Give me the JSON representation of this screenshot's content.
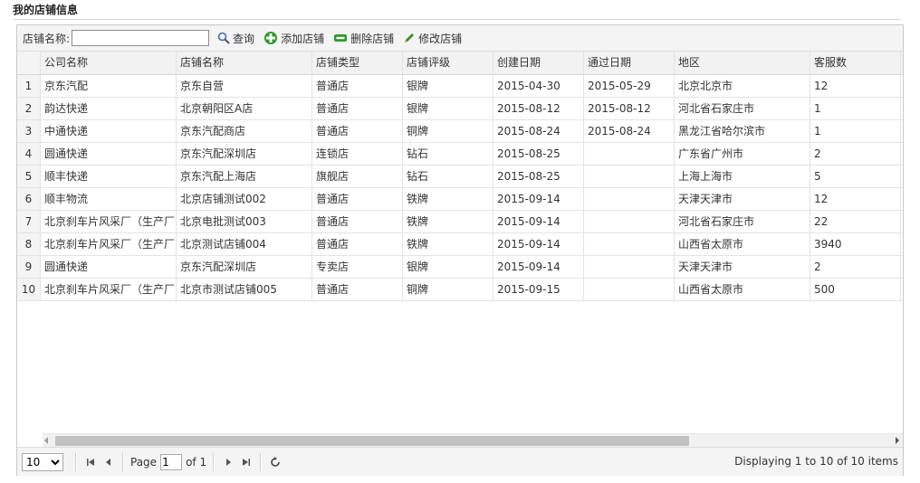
{
  "page_title": "我的店铺信息",
  "toolbar": {
    "search_label": "店铺名称:",
    "search_value": "",
    "query_label": "查询",
    "add_label": "添加店铺",
    "delete_label": "删除店铺",
    "edit_label": "修改店铺"
  },
  "columns": [
    "公司名称",
    "店铺名称",
    "店铺类型",
    "店铺评级",
    "创建日期",
    "通过日期",
    "地区",
    "客服数"
  ],
  "rows": [
    {
      "n": "1",
      "cells": [
        "京东汽配",
        "京东自营",
        "普通店",
        "银牌",
        "2015-04-30",
        "2015-05-29",
        "北京北京市",
        "12"
      ]
    },
    {
      "n": "2",
      "cells": [
        "韵达快递",
        "北京朝阳区A店",
        "普通店",
        "银牌",
        "2015-08-12",
        "2015-08-12",
        "河北省石家庄市",
        "1"
      ]
    },
    {
      "n": "3",
      "cells": [
        "中通快递",
        "京东汽配商店",
        "普通店",
        "铜牌",
        "2015-08-24",
        "2015-08-24",
        "黑龙江省哈尔滨市",
        "1"
      ]
    },
    {
      "n": "4",
      "cells": [
        "圆通快递",
        "京东汽配深圳店",
        "连锁店",
        "钻石",
        "2015-08-25",
        "",
        "广东省广州市",
        "2"
      ]
    },
    {
      "n": "5",
      "cells": [
        "顺丰快递",
        "京东汽配上海店",
        "旗舰店",
        "钻石",
        "2015-08-25",
        "",
        "上海上海市",
        "5"
      ]
    },
    {
      "n": "6",
      "cells": [
        "顺丰物流",
        "北京店铺测试002",
        "普通店",
        "铁牌",
        "2015-09-14",
        "",
        "天津天津市",
        "12"
      ]
    },
    {
      "n": "7",
      "cells": [
        "北京刹车片风采厂（生产厂",
        "北京电批测试003",
        "普通店",
        "铁牌",
        "2015-09-14",
        "",
        "河北省石家庄市",
        "22"
      ]
    },
    {
      "n": "8",
      "cells": [
        "北京刹车片风采厂（生产厂",
        "北京测试店铺004",
        "普通店",
        "铁牌",
        "2015-09-14",
        "",
        "山西省太原市",
        "3940"
      ]
    },
    {
      "n": "9",
      "cells": [
        "圆通快递",
        "京东汽配深圳店",
        "专卖店",
        "银牌",
        "2015-09-14",
        "",
        "天津天津市",
        "2"
      ]
    },
    {
      "n": "10",
      "cells": [
        "北京刹车片风采厂（生产厂",
        "北京市测试店铺005",
        "普通店",
        "铜牌",
        "2015-09-15",
        "",
        "山西省太原市",
        "500"
      ]
    }
  ],
  "pager": {
    "page_size": "10",
    "page_label": "Page",
    "page_number": "1",
    "of_label": "of 1",
    "info": "Displaying 1 to 10 of 10 items"
  },
  "colors": {
    "add_icon": "#2e9a2e",
    "delete_icon": "#2e9a2e",
    "edit_icon": "#3a8a2a",
    "search_icon": "#3b6fb6"
  }
}
